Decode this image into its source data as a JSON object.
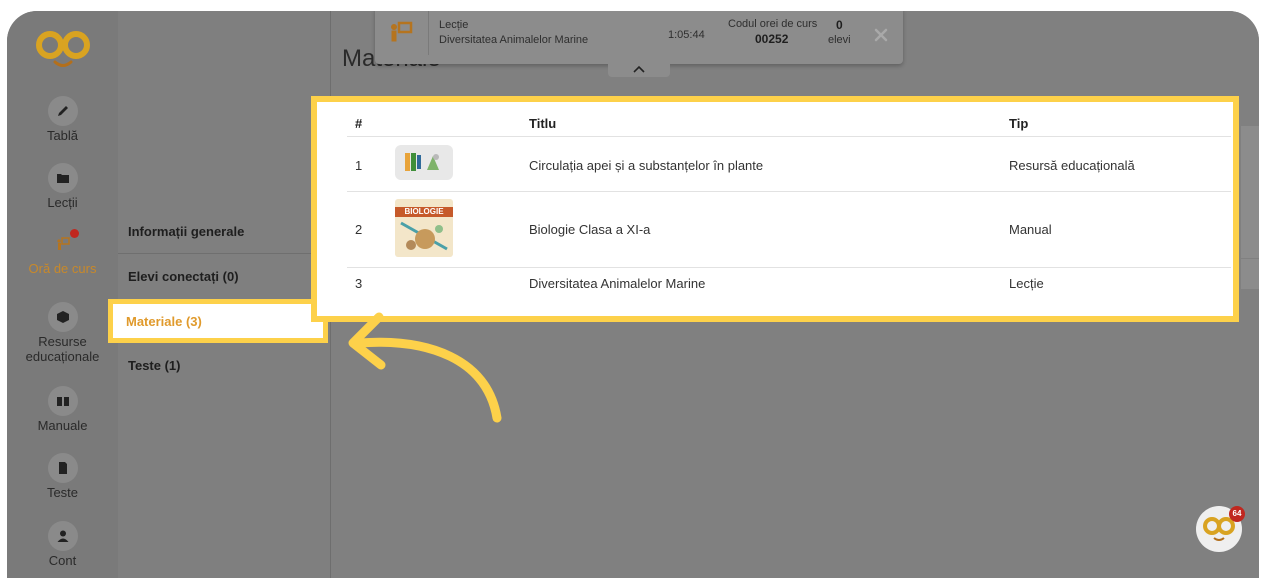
{
  "rail": {
    "items": [
      {
        "label": "Tablă",
        "icon": "pencil-icon"
      },
      {
        "label": "Lecții",
        "icon": "folder-icon"
      },
      {
        "label": "Oră de curs",
        "icon": "teacher-icon"
      },
      {
        "label": "Resurse",
        "label2": "educaționale",
        "icon": "cube-icon"
      },
      {
        "label": "Manuale",
        "icon": "book-icon"
      },
      {
        "label": "Teste",
        "icon": "file-icon"
      },
      {
        "label": "Cont",
        "icon": "user-icon"
      }
    ]
  },
  "subnav": {
    "items": [
      "Informații generale",
      "Elevi conectați (0)",
      "Materiale (3)",
      "Teste (1)"
    ]
  },
  "main": {
    "title": "Materiale"
  },
  "session": {
    "type_label": "Lecție",
    "name": "Diversitatea Animalelor Marine",
    "timer": "1:05:44",
    "code_label": "Codul orei de curs",
    "code": "00252",
    "students_count": "0",
    "students_label": "elevi"
  },
  "table": {
    "headers": [
      "#",
      "Titlu",
      "Tip"
    ],
    "rows": [
      {
        "num": "1",
        "title": "Circulația apei și a substanțelor în plante",
        "type": "Resursă educațională"
      },
      {
        "num": "2",
        "title": "Biologie Clasa a XI-a",
        "type": "Manual",
        "cover_title": "BIOLOGIE"
      },
      {
        "num": "3",
        "title": "Diversitatea Animalelor Marine",
        "type": "Lecție"
      }
    ]
  },
  "chat": {
    "badge": "64"
  },
  "colors": {
    "accent": "#fdd14a",
    "active": "#e09a2c",
    "overlay": "#808080",
    "badge": "#c0271f"
  }
}
